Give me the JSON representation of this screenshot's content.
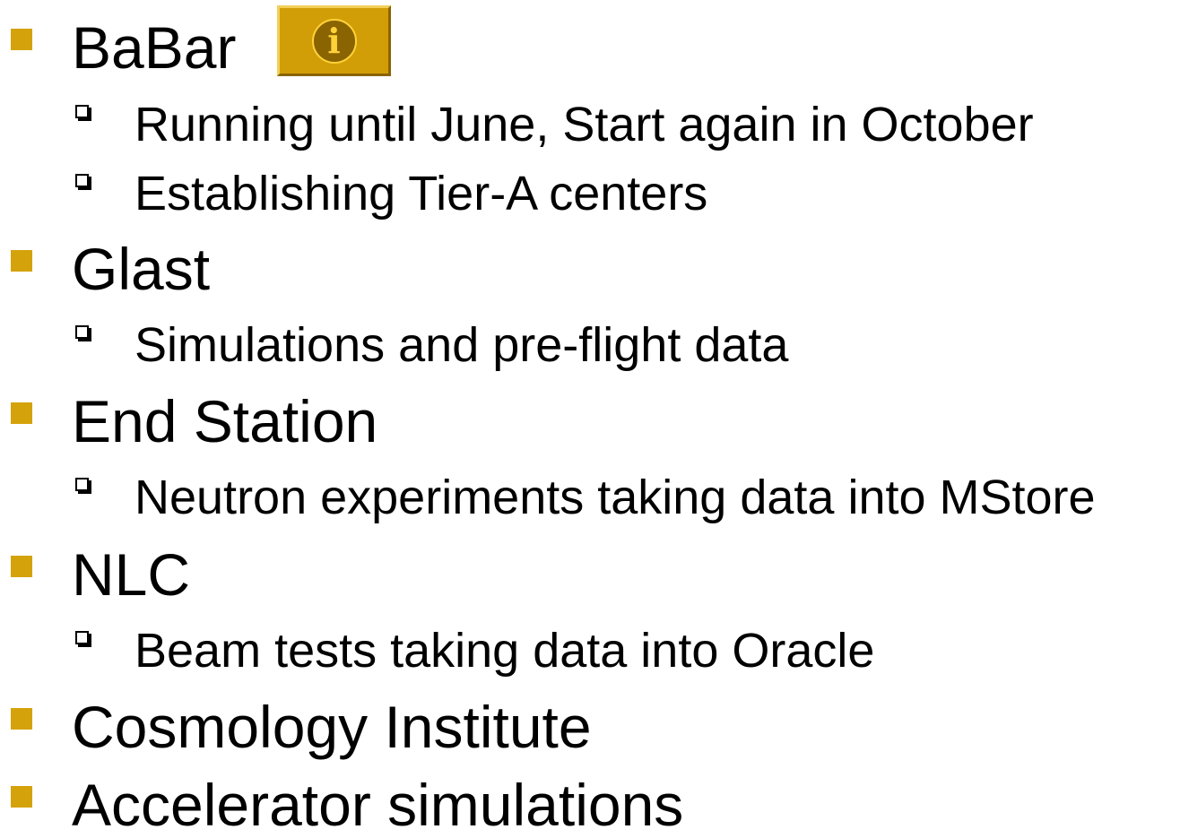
{
  "colors": {
    "level1_bullet": "#d4a20a",
    "info_button": "#d19e07"
  },
  "info_button": {
    "icon": "info-icon",
    "glyph": "i"
  },
  "items": [
    {
      "label": "BaBar",
      "subitems": [
        "Running until June, Start again in October",
        "Establishing Tier-A centers"
      ]
    },
    {
      "label": "Glast",
      "subitems": [
        "Simulations and pre-flight data"
      ]
    },
    {
      "label": "End Station",
      "subitems": [
        "Neutron experiments taking data into MStore"
      ]
    },
    {
      "label": "NLC",
      "subitems": [
        "Beam tests taking data into Oracle"
      ]
    },
    {
      "label": "Cosmology Institute",
      "subitems": []
    },
    {
      "label": "Accelerator simulations",
      "subitems": []
    }
  ]
}
